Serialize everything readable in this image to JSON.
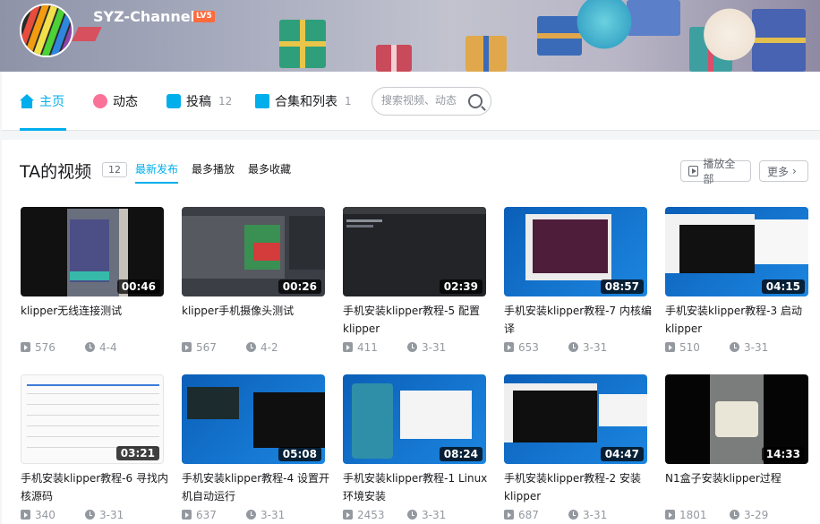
{
  "header": {
    "username": "SYZ-Channel",
    "level": "LV5"
  },
  "nav": {
    "items": [
      {
        "label": "主页",
        "count": ""
      },
      {
        "label": "动态",
        "count": ""
      },
      {
        "label": "投稿",
        "count": "12"
      },
      {
        "label": "合集和列表",
        "count": "1"
      }
    ],
    "search_placeholder": "搜索视频、动态"
  },
  "section": {
    "title": "TA的视频",
    "count": "12",
    "tabs": [
      "最新发布",
      "最多播放",
      "最多收藏"
    ],
    "play_all": "播放全部",
    "more": "更多"
  },
  "videos": [
    {
      "title": "klipper无线连接测试",
      "duration": "00:46",
      "plays": "576",
      "date": "4-4"
    },
    {
      "title": "klipper手机摄像头测试",
      "duration": "00:26",
      "plays": "567",
      "date": "4-2"
    },
    {
      "title": "手机安装klipper教程-5 配置klipper",
      "duration": "02:39",
      "plays": "411",
      "date": "3-31"
    },
    {
      "title": "手机安装klipper教程-7 内核编译",
      "duration": "08:57",
      "plays": "653",
      "date": "3-31"
    },
    {
      "title": "手机安装klipper教程-3 启动klipper",
      "duration": "04:15",
      "plays": "510",
      "date": "3-31"
    },
    {
      "title": "手机安装klipper教程-6 寻找内核源码",
      "duration": "03:21",
      "plays": "340",
      "date": "3-31"
    },
    {
      "title": "手机安装klipper教程-4 设置开机自动运行",
      "duration": "05:08",
      "plays": "637",
      "date": "3-31"
    },
    {
      "title": "手机安装klipper教程-1 Linux环境安装",
      "duration": "08:24",
      "plays": "2453",
      "date": "3-31"
    },
    {
      "title": "手机安装klipper教程-2 安装klipper",
      "duration": "04:47",
      "plays": "687",
      "date": "3-31"
    },
    {
      "title": "N1盒子安装klipper过程",
      "duration": "14:33",
      "plays": "1801",
      "date": "3-29"
    }
  ],
  "colors": {
    "accent": "#00aeec",
    "text": "#18191c",
    "muted": "#9499a0"
  }
}
